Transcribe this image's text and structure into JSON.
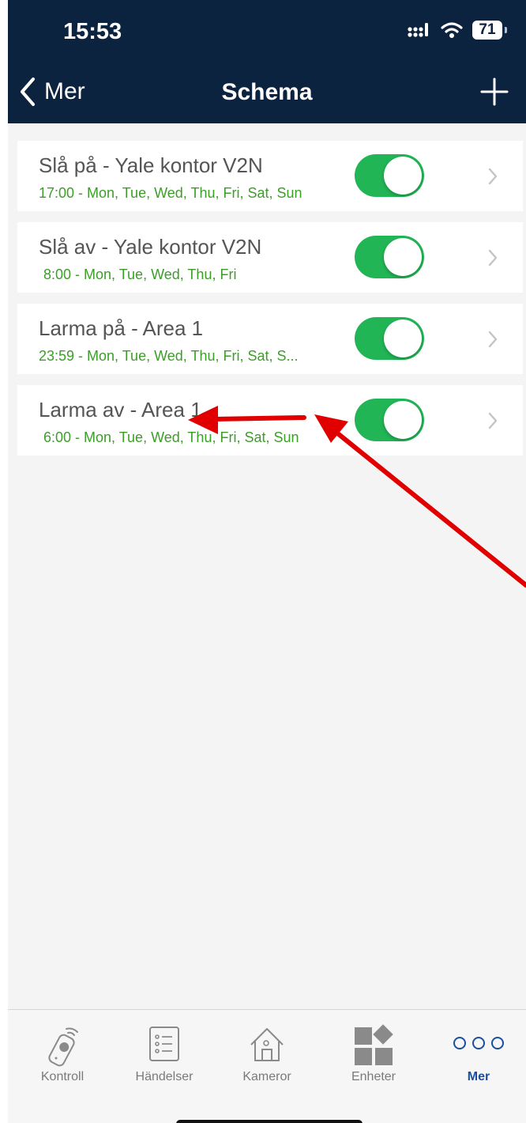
{
  "status_bar": {
    "time": "15:53",
    "battery": "71"
  },
  "nav": {
    "back_label": "Mer",
    "title": "Schema"
  },
  "schedules": [
    {
      "title": "Slå på - Yale kontor V2N",
      "subtitle": "17:00 - Mon, Tue, Wed, Thu, Fri, Sat, Sun",
      "enabled": true
    },
    {
      "title": "Slå av - Yale kontor V2N",
      "subtitle": "8:00 - Mon, Tue, Wed, Thu, Fri",
      "enabled": true
    },
    {
      "title": "Larma på - Area 1",
      "subtitle": "23:59 - Mon, Tue, Wed, Thu, Fri, Sat, S...",
      "enabled": true
    },
    {
      "title": "Larma av - Area 1",
      "subtitle": "6:00 - Mon, Tue, Wed, Thu, Fri, Sat, Sun",
      "enabled": true
    }
  ],
  "tabs": [
    {
      "label": "Kontroll",
      "icon": "remote-control-icon"
    },
    {
      "label": "Händelser",
      "icon": "event-list-icon"
    },
    {
      "label": "Kameror",
      "icon": "camera-house-icon"
    },
    {
      "label": "Enheter",
      "icon": "devices-grid-icon"
    },
    {
      "label": "Mer",
      "icon": "more-dots-icon",
      "active": true
    }
  ],
  "colors": {
    "header": "#0c2340",
    "toggle_on": "#21b555",
    "subtitle_green": "#3c9e28",
    "active_tab": "#1a4fa0",
    "annotation_arrow": "#e00000"
  }
}
